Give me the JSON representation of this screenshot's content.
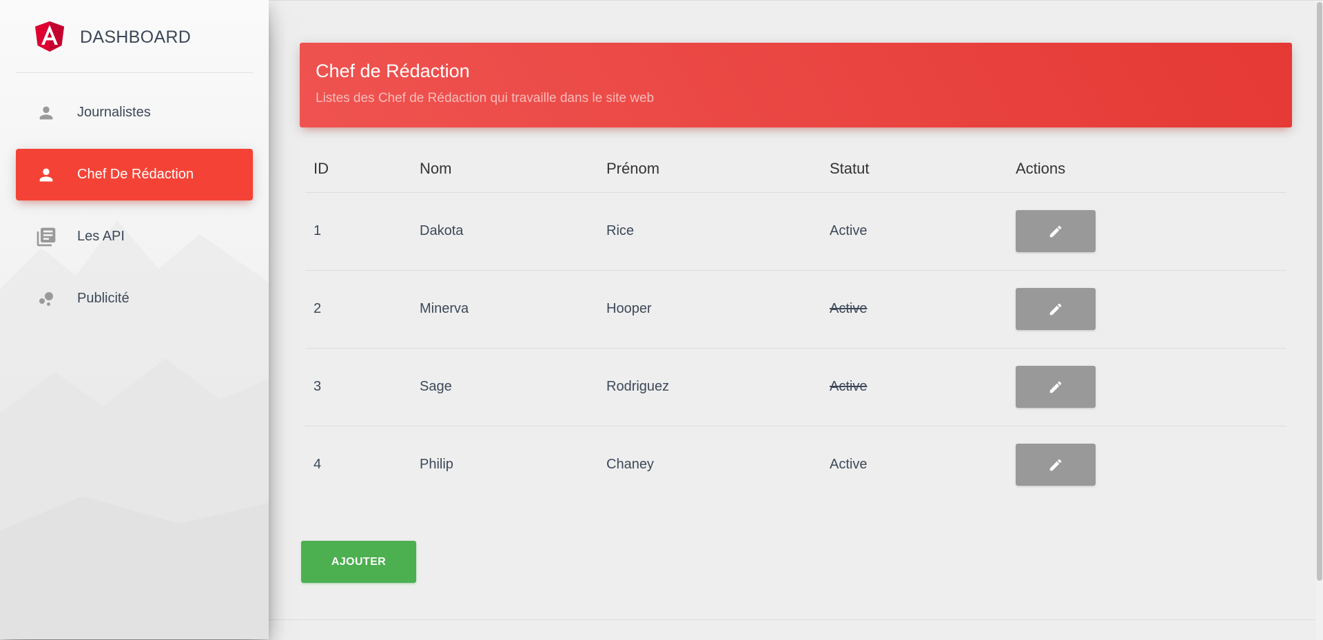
{
  "sidebar": {
    "brand": {
      "title": "DASHBOARD",
      "logo": "angular-logo-icon"
    },
    "items": [
      {
        "label": "Journalistes",
        "icon": "person-icon",
        "active": false
      },
      {
        "label": "Chef De Rédaction",
        "icon": "person-icon",
        "active": true
      },
      {
        "label": "Les API",
        "icon": "library-books-icon",
        "active": false
      },
      {
        "label": "Publicité",
        "icon": "bubble-chart-icon",
        "active": false
      }
    ]
  },
  "card": {
    "title": "Chef de Rédaction",
    "subtitle": "Listes des Chef de Rédaction qui travaille dans le site web"
  },
  "table": {
    "headers": {
      "id": "ID",
      "nom": "Nom",
      "prenom": "Prénom",
      "statut": "Statut",
      "actions": "Actions"
    },
    "rows": [
      {
        "id": "1",
        "nom": "Dakota",
        "prenom": "Rice",
        "statut": "Active",
        "struck": false
      },
      {
        "id": "2",
        "nom": "Minerva",
        "prenom": "Hooper",
        "statut": "Active",
        "struck": true
      },
      {
        "id": "3",
        "nom": "Sage",
        "prenom": "Rodriguez",
        "statut": "Active",
        "struck": true
      },
      {
        "id": "4",
        "nom": "Philip",
        "prenom": "Chaney",
        "statut": "Active",
        "struck": false
      }
    ],
    "edit_icon": "pencil-icon"
  },
  "actions": {
    "add_label": "AJOUTER"
  },
  "colors": {
    "accent": "#f44336",
    "header_gradient_start": "#ef5350",
    "header_gradient_end": "#e53935",
    "edit_button": "#999999",
    "add_button": "#4caf50"
  }
}
